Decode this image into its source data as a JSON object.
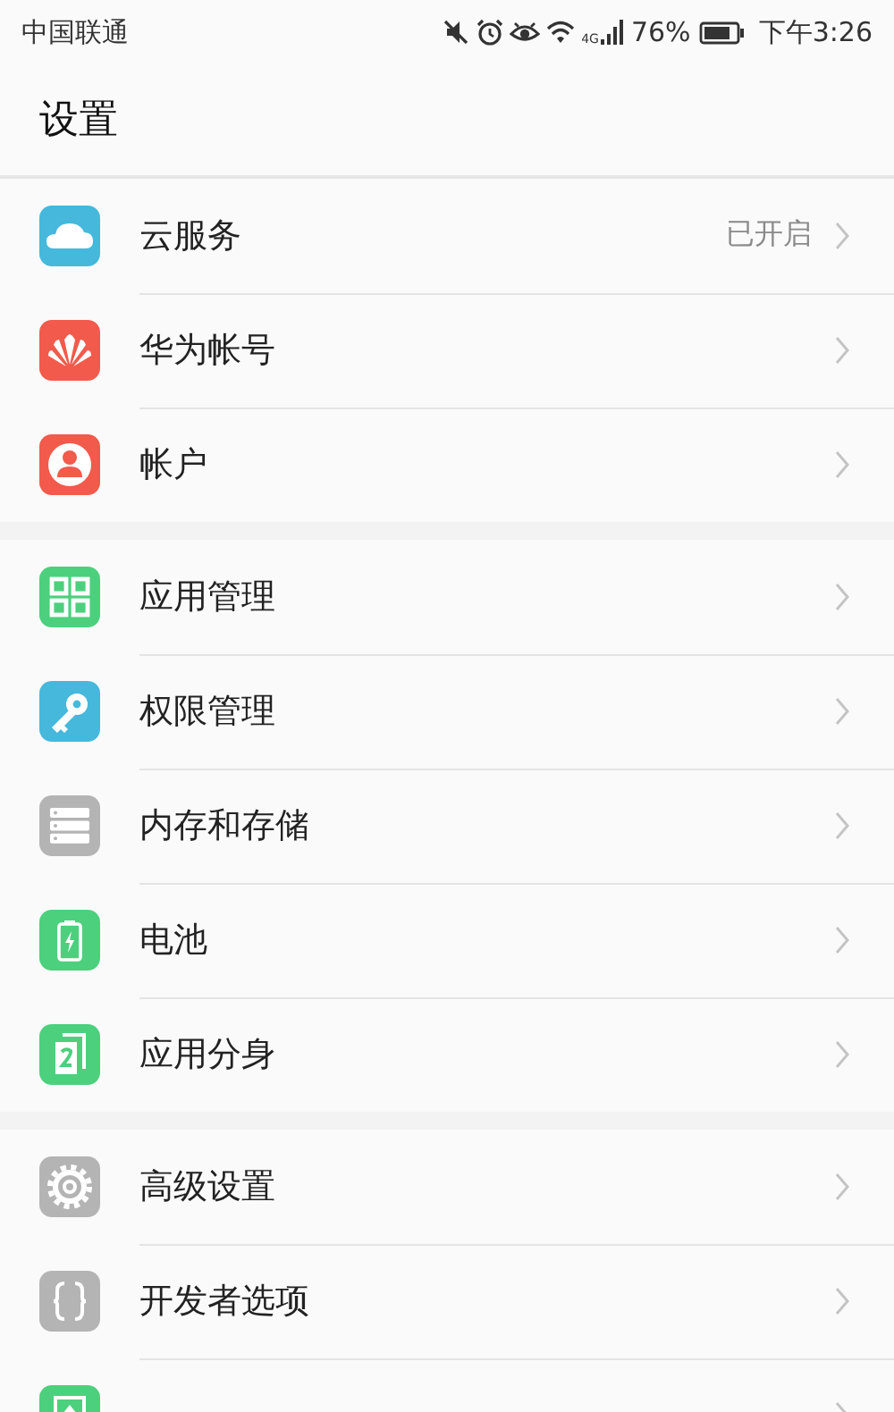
{
  "status_bar": {
    "carrier": "中国联通",
    "network": "4G",
    "battery_percent": "76%",
    "time": "下午3:26"
  },
  "title": "设置",
  "groups": [
    {
      "items": [
        {
          "label": "云服务",
          "color": "#45b8dc",
          "value": "已开启"
        },
        {
          "label": "华为帐号",
          "color": "#f25a4b"
        },
        {
          "label": "帐户",
          "color": "#f25a4b"
        }
      ]
    },
    {
      "items": [
        {
          "label": "应用管理",
          "color": "#4cd07d"
        },
        {
          "label": "权限管理",
          "color": "#45b8dc"
        },
        {
          "label": "内存和存储",
          "color": "#b4b4b4"
        },
        {
          "label": "电池",
          "color": "#4cd07d"
        },
        {
          "label": "应用分身",
          "color": "#4cd07d"
        }
      ]
    },
    {
      "items": [
        {
          "label": "高级设置",
          "color": "#b4b4b4"
        },
        {
          "label": "开发者选项",
          "color": "#b4b4b4"
        },
        {
          "color": "#4cd07d"
        }
      ]
    }
  ]
}
